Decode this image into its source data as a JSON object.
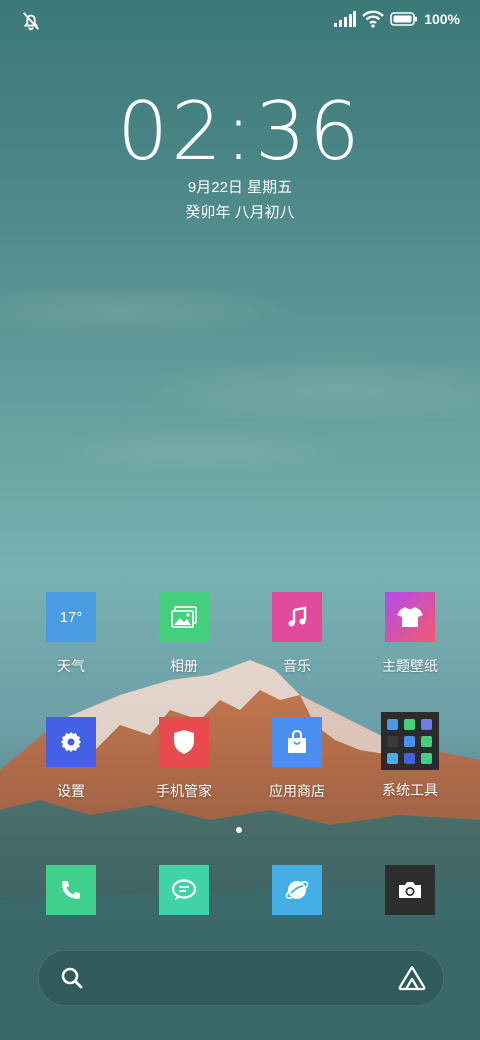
{
  "status_bar": {
    "battery_text": "100%",
    "icons": [
      "mute-bell-icon",
      "signal-icon",
      "wifi-icon",
      "battery-icon"
    ]
  },
  "lockscreen": {
    "time": "02:36",
    "date": "9月22日 星期五",
    "lunar": "癸卯年 八月初八"
  },
  "apps": [
    {
      "label": "天气",
      "icon": "weather-icon",
      "tile_text": "17°"
    },
    {
      "label": "相册",
      "icon": "gallery-icon"
    },
    {
      "label": "音乐",
      "icon": "music-note-icon"
    },
    {
      "label": "主题壁纸",
      "icon": "tshirt-icon"
    },
    {
      "label": "设置",
      "icon": "gear-icon"
    },
    {
      "label": "手机管家",
      "icon": "shield-icon"
    },
    {
      "label": "应用商店",
      "icon": "shopping-bag-icon"
    },
    {
      "label": "系统工具",
      "icon": "folder-icon"
    }
  ],
  "dock": [
    {
      "icon": "phone-icon"
    },
    {
      "icon": "chat-bubble-icon"
    },
    {
      "icon": "planet-browser-icon"
    },
    {
      "icon": "camera-icon"
    }
  ],
  "search": {
    "icons": [
      "search-icon",
      "assistant-icon"
    ]
  },
  "colors": {
    "weather": "#4a9be2",
    "gallery": "#43cf7d",
    "music": "#e24a9b",
    "settings": "#4460e4",
    "security": "#e84a4f",
    "store": "#4a8ef0",
    "phone": "#3fd18b",
    "messages": "#40d3a8",
    "browser": "#45aee4",
    "camera": "#2d2d2d"
  }
}
